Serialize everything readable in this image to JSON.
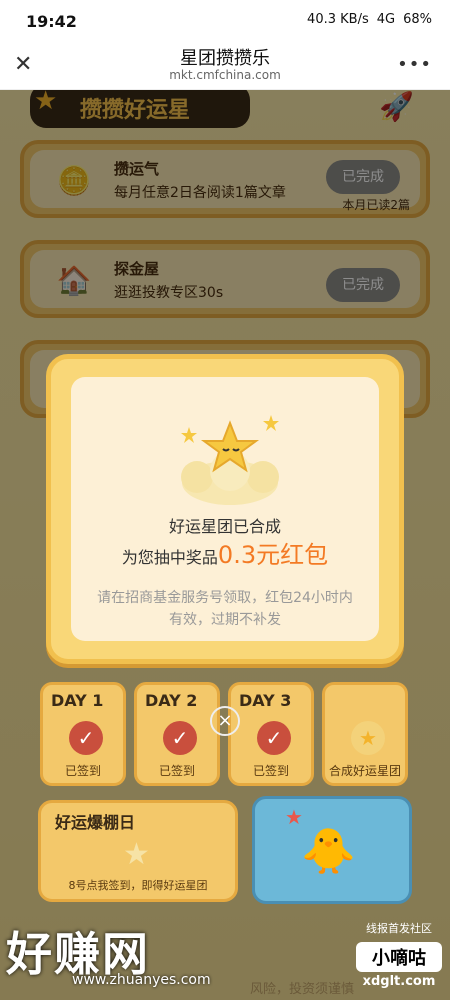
{
  "status": {
    "time": "19:42",
    "net_speed": "40.3 KB/s",
    "signal": "4G",
    "battery": "68%"
  },
  "nav": {
    "title": "星团攒攒乐",
    "url": "mkt.cmfchina.com",
    "close_glyph": "✕",
    "more_glyph": "•••"
  },
  "header": {
    "title": "攒攒好运星"
  },
  "tasks": [
    {
      "title": "攒运气",
      "desc": "每月任意2日各阅读1篇文章",
      "button": "已完成",
      "note": "本月已读2篇"
    },
    {
      "title": "探金屋",
      "desc": "逛逛投教专区30s",
      "button": "已完成"
    }
  ],
  "modal": {
    "line1": "好运星团已合成",
    "line2_prefix": "为您抽中奖品",
    "prize": "0.3元红包",
    "note": "请在招商基金服务号领取，红包24小时内有效，过期不补发"
  },
  "days": [
    {
      "label": "DAY 1",
      "status": "已签到"
    },
    {
      "label": "DAY 2",
      "status": "已签到"
    },
    {
      "label": "DAY 3",
      "status": "已签到"
    },
    {
      "label": "",
      "status": "合成好运星团"
    }
  ],
  "bonus": {
    "title": "好运爆棚日",
    "note": "8号点我签到，即得好运星团"
  },
  "watermark": {
    "left": "好赚网",
    "url": "www.zhuanyes.com",
    "right_top": "线报首发社区",
    "right_box": "小嘀咕",
    "right_domain": "xdglt.com"
  },
  "footer_text": "风险，投资须谨慎"
}
